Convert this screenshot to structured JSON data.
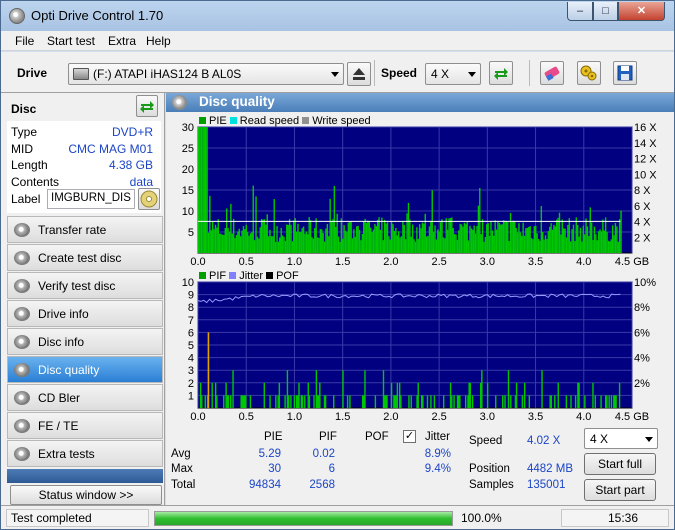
{
  "window": {
    "title": "Opti Drive Control 1.70",
    "min": "–",
    "max": "□",
    "close": "✕"
  },
  "menu": [
    "File",
    "Start test",
    "Extra",
    "Help"
  ],
  "toolbar": {
    "drive_label": "Drive",
    "drive_value": "(F:)   ATAPI iHAS124   B AL0S",
    "speed_label": "Speed",
    "speed_value": "4 X"
  },
  "disc": {
    "header": "Disc",
    "rows": [
      {
        "k": "Type",
        "v": "DVD+R"
      },
      {
        "k": "MID",
        "v": "CMC MAG M01"
      },
      {
        "k": "Length",
        "v": "4.38 GB"
      },
      {
        "k": "Contents",
        "v": "data"
      }
    ],
    "label_key": "Label",
    "label_value": "IMGBURN_DIS"
  },
  "nav": [
    {
      "label": "Transfer rate",
      "active": false
    },
    {
      "label": "Create test disc",
      "active": false
    },
    {
      "label": "Verify test disc",
      "active": false
    },
    {
      "label": "Drive info",
      "active": false
    },
    {
      "label": "Disc info",
      "active": false
    },
    {
      "label": "Disc quality",
      "active": true
    },
    {
      "label": "CD Bler",
      "active": false
    },
    {
      "label": "FE / TE",
      "active": false
    },
    {
      "label": "Extra tests",
      "active": false
    }
  ],
  "status_window_button": "Status window >>",
  "panel_title": "Disc quality",
  "chart_data": [
    {
      "type": "bar",
      "legend": [
        {
          "name": "PIE",
          "color": "#00a000"
        },
        {
          "name": "Read speed",
          "color": "#00e0e0"
        },
        {
          "name": "Write speed",
          "color": "#909090"
        }
      ],
      "xlim": [
        0,
        4.5
      ],
      "x_ticks": [
        "0.0",
        "0.5",
        "1.0",
        "1.5",
        "2.0",
        "2.5",
        "3.0",
        "3.5",
        "4.0",
        "4.5 GB"
      ],
      "ylim": [
        0,
        30
      ],
      "y_ticks_left": [
        "30",
        "25",
        "20",
        "15",
        "10",
        "5"
      ],
      "y_ticks_right": [
        "16 X",
        "14 X",
        "12 X",
        "10 X",
        "8 X",
        "6 X",
        "4 X",
        "2 X"
      ],
      "pie_average": 5.29,
      "pie_max": 30,
      "read_speed_x": 4.02,
      "data_end_gb": 4.38
    },
    {
      "type": "bar",
      "legend": [
        {
          "name": "PIF",
          "color": "#00a000"
        },
        {
          "name": "Jitter",
          "color": "#8080ff"
        },
        {
          "name": "POF",
          "color": "#000000"
        }
      ],
      "xlim": [
        0,
        4.5
      ],
      "x_ticks": [
        "0.0",
        "0.5",
        "1.0",
        "1.5",
        "2.0",
        "2.5",
        "3.0",
        "3.5",
        "4.0",
        "4.5 GB"
      ],
      "ylim": [
        0,
        10
      ],
      "y_ticks_left": [
        "10",
        "9",
        "8",
        "7",
        "6",
        "5",
        "4",
        "3",
        "2",
        "1"
      ],
      "y_ticks_right": [
        "10%",
        "8%",
        "6%",
        "4%",
        "2%"
      ],
      "pif_max": 6,
      "jitter_average_pct": 8.9,
      "jitter_max_pct": 9.4
    }
  ],
  "stats": {
    "headers": [
      "PIE",
      "PIF",
      "POF",
      "Jitter"
    ],
    "rows": [
      {
        "label": "Avg",
        "pie": "5.29",
        "pif": "0.02",
        "jitter": "8.9%"
      },
      {
        "label": "Max",
        "pie": "30",
        "pif": "6",
        "jitter": "9.4%"
      },
      {
        "label": "Total",
        "pie": "94834",
        "pif": "2568",
        "jitter": ""
      }
    ],
    "jitter_checked": true,
    "speed_label": "Speed",
    "speed_value": "4.02 X",
    "position_label": "Position",
    "position_value": "4482 MB",
    "samples_label": "Samples",
    "samples_value": "135001",
    "speed_select": "4 X",
    "start_full": "Start full",
    "start_part": "Start part"
  },
  "status": {
    "text": "Test completed",
    "progress_pct": 100,
    "progress_label": "100.0%",
    "time": "15:36"
  },
  "colors": {
    "plot_bg": "#000080",
    "grid": "#3a3aa8",
    "pie": "#00c800",
    "jitter": "#9a9aff",
    "accent": "#2a7fd4"
  }
}
